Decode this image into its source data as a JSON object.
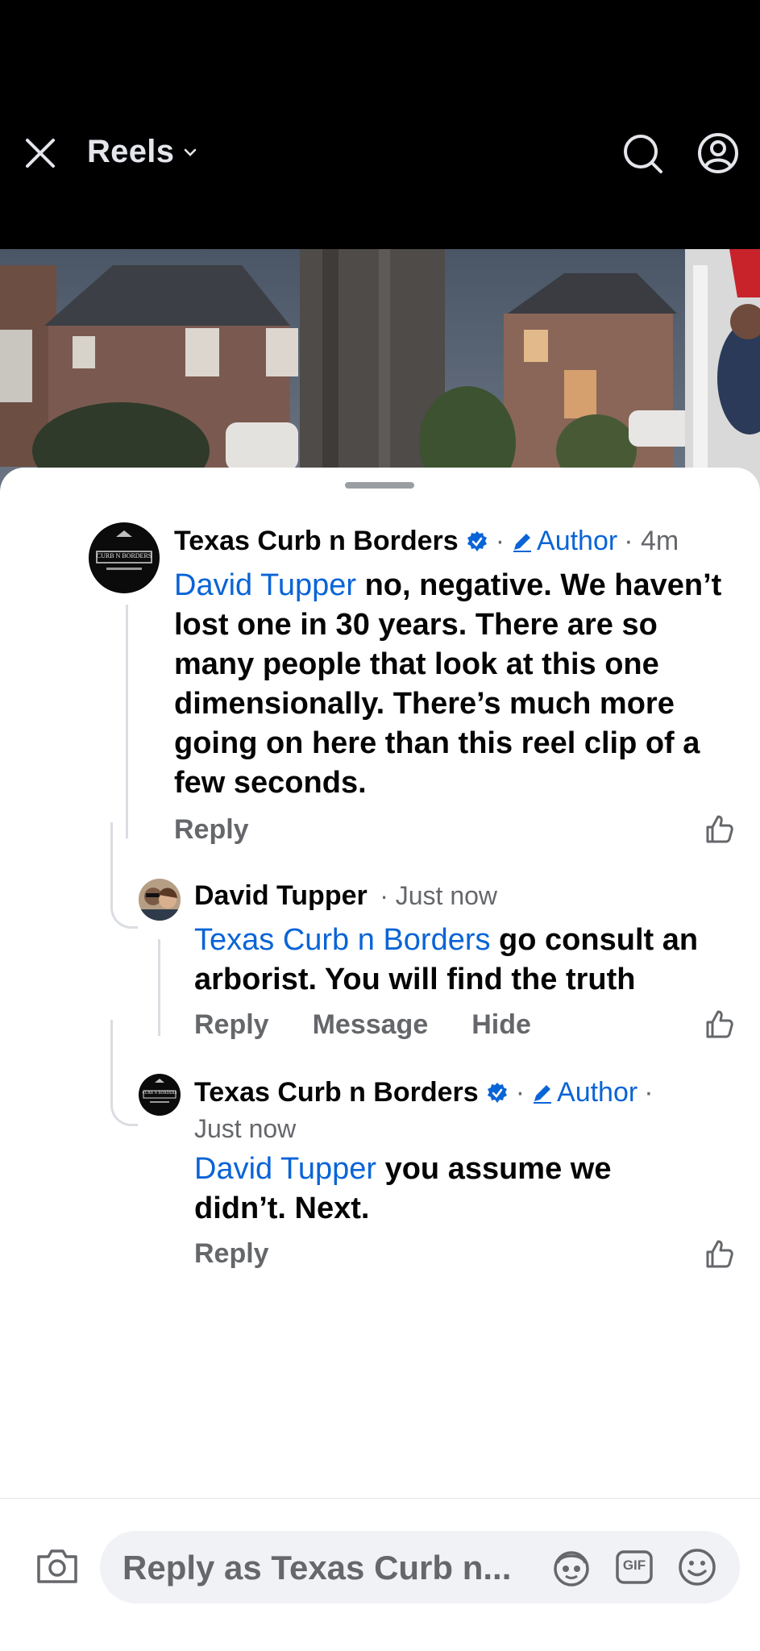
{
  "topbar": {
    "title": "Reels"
  },
  "comments": [
    {
      "author": "Texas Curb n Borders",
      "verified": true,
      "author_badge": "Author",
      "time": "· 4m",
      "mention": "David Tupper",
      "text": " no, negative. We haven’t lost one in 30 years. There are so many people that look at this one dimensionally. There’s much more going on here than this reel clip of a few seconds.",
      "actions": [
        "Reply"
      ],
      "avatar_logo_text": "CURB N BORDERS"
    },
    {
      "author": "David Tupper",
      "time": "· Just now",
      "mention": "Texas Curb n Borders",
      "text": " go consult an arborist.  You will find the truth",
      "actions": [
        "Reply",
        "Message",
        "Hide"
      ]
    },
    {
      "author": "Texas Curb n Borders",
      "verified": true,
      "author_badge": "Author",
      "time_line": "Just now",
      "mention": "David Tupper",
      "text": " you assume we didn’t. Next.",
      "actions": [
        "Reply"
      ],
      "avatar_logo_text": "CURB N BORDERS"
    }
  ],
  "composer": {
    "placeholder": "Reply as Texas Curb n...",
    "gif_label": "GIF"
  },
  "icons": {
    "close": "close-icon",
    "dropdown": "chevron-down-icon",
    "search": "search-icon",
    "profile": "profile-icon",
    "verified": "verified-badge-icon",
    "author": "pencil-icon",
    "like": "thumbs-up-icon",
    "camera": "camera-icon",
    "avatar_frame": "avatar-frame-icon",
    "gif": "gif-icon",
    "emoji": "emoji-icon"
  },
  "colors": {
    "link": "#0a64d6",
    "meta": "#65676b",
    "background": "#ffffff",
    "topbar": "#000000"
  }
}
